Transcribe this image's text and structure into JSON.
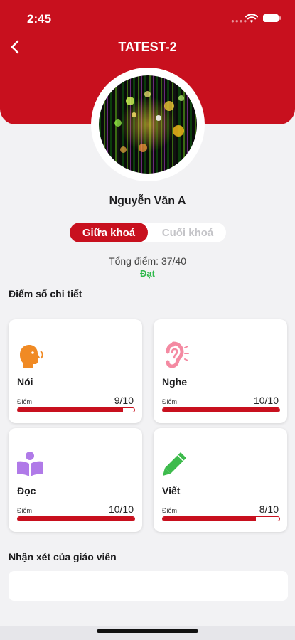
{
  "status_bar": {
    "time": "2:45"
  },
  "header": {
    "title": "TATEST-2"
  },
  "profile": {
    "name": "Nguyễn Văn A"
  },
  "tabs": [
    {
      "label": "Giữa khoá",
      "active": true
    },
    {
      "label": "Cuối khoá",
      "active": false
    }
  ],
  "summary": {
    "total": "Tổng điểm: 37/40",
    "result": "Đạt"
  },
  "details": {
    "title": "Điểm số chi tiết",
    "score_label": "Điểm",
    "skills": [
      {
        "name": "Nói",
        "score": "9/10",
        "progress": 0.9,
        "icon": "speaking-head-icon",
        "icon_color": "#f08a24"
      },
      {
        "name": "Nghe",
        "score": "10/10",
        "progress": 1.0,
        "icon": "ear-icon",
        "icon_color": "#f48aa2"
      },
      {
        "name": "Đọc",
        "score": "10/10",
        "progress": 1.0,
        "icon": "reading-book-icon",
        "icon_color": "#b07ae8"
      },
      {
        "name": "Viết",
        "score": "8/10",
        "progress": 0.8,
        "icon": "pencil-icon",
        "icon_color": "#3dbb4c"
      }
    ]
  },
  "comments": {
    "title": "Nhận xét của giáo viên",
    "text": ""
  },
  "colors": {
    "primary": "#c8101e",
    "pass": "#2fb84a",
    "background": "#f2f2f4"
  }
}
